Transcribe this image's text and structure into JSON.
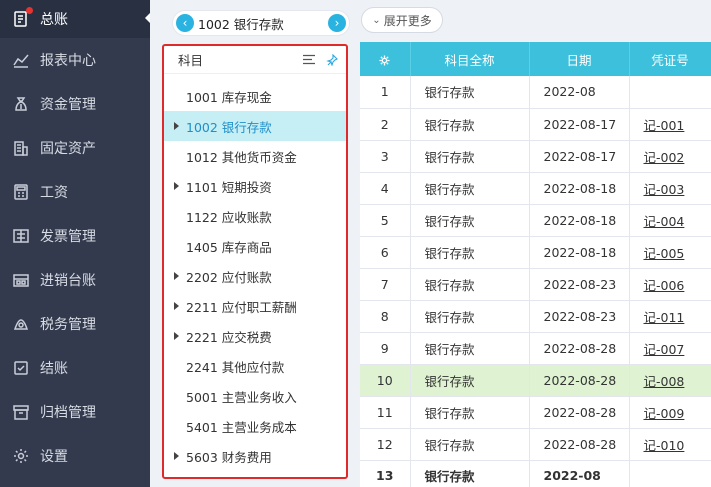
{
  "sidebar": {
    "items": [
      {
        "label": "总账",
        "icon": "ledger-icon",
        "active": true
      },
      {
        "label": "报表中心",
        "icon": "chart-icon"
      },
      {
        "label": "资金管理",
        "icon": "money-bag-icon"
      },
      {
        "label": "固定资产",
        "icon": "building-icon"
      },
      {
        "label": "工资",
        "icon": "calculator-icon"
      },
      {
        "label": "发票管理",
        "icon": "invoice-icon"
      },
      {
        "label": "进销台账",
        "icon": "inventory-icon"
      },
      {
        "label": "税务管理",
        "icon": "tax-icon"
      },
      {
        "label": "结账",
        "icon": "close-books-icon"
      },
      {
        "label": "归档管理",
        "icon": "archive-icon"
      },
      {
        "label": "设置",
        "icon": "gear-icon"
      }
    ]
  },
  "topbar": {
    "account_label": "1002 银行存款",
    "expand_label": "展开更多"
  },
  "subject_panel": {
    "title": "科目",
    "items": [
      {
        "label": "1001 库存现金",
        "expandable": false
      },
      {
        "label": "1002 银行存款",
        "expandable": true,
        "selected": true
      },
      {
        "label": "1012 其他货币资金",
        "expandable": false
      },
      {
        "label": "1101 短期投资",
        "expandable": true
      },
      {
        "label": "1122 应收账款",
        "expandable": false
      },
      {
        "label": "1405 库存商品",
        "expandable": false
      },
      {
        "label": "2202 应付账款",
        "expandable": true
      },
      {
        "label": "2211 应付职工薪酬",
        "expandable": true
      },
      {
        "label": "2221 应交税费",
        "expandable": true
      },
      {
        "label": "2241 其他应付款",
        "expandable": false
      },
      {
        "label": "5001 主营业务收入",
        "expandable": false
      },
      {
        "label": "5401 主营业务成本",
        "expandable": false
      },
      {
        "label": "5603 财务费用",
        "expandable": true
      }
    ]
  },
  "table": {
    "headers": [
      "",
      "科目全称",
      "日期",
      "凭证号"
    ],
    "rows": [
      {
        "n": "1",
        "name": "银行存款",
        "date": "2022-08",
        "voucher": ""
      },
      {
        "n": "2",
        "name": "银行存款",
        "date": "2022-08-17",
        "voucher": "记-001"
      },
      {
        "n": "3",
        "name": "银行存款",
        "date": "2022-08-17",
        "voucher": "记-002"
      },
      {
        "n": "4",
        "name": "银行存款",
        "date": "2022-08-18",
        "voucher": "记-003"
      },
      {
        "n": "5",
        "name": "银行存款",
        "date": "2022-08-18",
        "voucher": "记-004"
      },
      {
        "n": "6",
        "name": "银行存款",
        "date": "2022-08-18",
        "voucher": "记-005"
      },
      {
        "n": "7",
        "name": "银行存款",
        "date": "2022-08-23",
        "voucher": "记-006"
      },
      {
        "n": "8",
        "name": "银行存款",
        "date": "2022-08-23",
        "voucher": "记-011"
      },
      {
        "n": "9",
        "name": "银行存款",
        "date": "2022-08-28",
        "voucher": "记-007"
      },
      {
        "n": "10",
        "name": "银行存款",
        "date": "2022-08-28",
        "voucher": "记-008",
        "highlight": true
      },
      {
        "n": "11",
        "name": "银行存款",
        "date": "2022-08-28",
        "voucher": "记-009"
      },
      {
        "n": "12",
        "name": "银行存款",
        "date": "2022-08-28",
        "voucher": "记-010"
      },
      {
        "n": "13",
        "name": "银行存款",
        "date": "2022-08",
        "voucher": "",
        "total": true
      }
    ]
  },
  "colors": {
    "sidebar_bg": "#333a4d",
    "header_teal": "#3cc0dc",
    "selected_bg": "#c6eef5",
    "highlight_row": "#dff3d3",
    "panel_border": "#e0292b"
  }
}
